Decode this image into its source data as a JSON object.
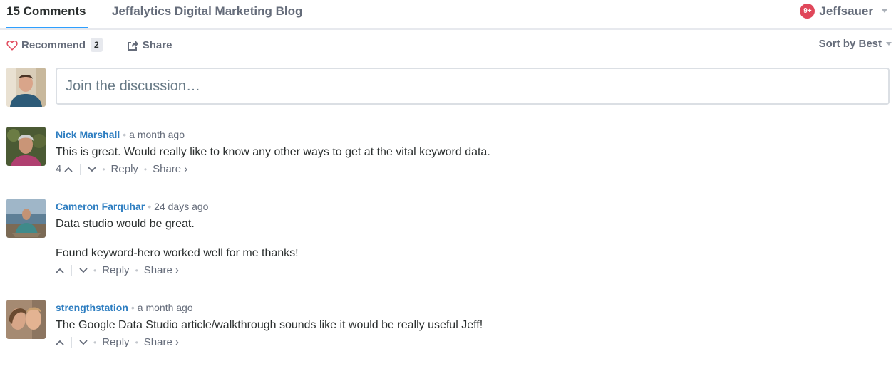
{
  "nav": {
    "comments_tab": "15 Comments",
    "blog_tab": "Jeffalytics Digital Marketing Blog",
    "notification_badge": "9+",
    "user_name": "Jeffsauer"
  },
  "actions": {
    "recommend_label": "Recommend",
    "recommend_count": "2",
    "share_label": "Share",
    "sort_label": "Sort by Best"
  },
  "compose": {
    "placeholder": "Join the discussion…"
  },
  "colors": {
    "accent": "#2e9fff",
    "author_link": "#2e7ec1",
    "notification": "#e0475a",
    "heart": "#e0475a"
  },
  "comments": [
    {
      "author": "Nick Marshall",
      "time": "a month ago",
      "paragraphs": [
        "This is great. Would really like to know any other ways to get at the vital keyword data."
      ],
      "upvotes": "4",
      "reply_label": "Reply",
      "share_label": "Share ›"
    },
    {
      "author": "Cameron Farquhar",
      "time": "24 days ago",
      "paragraphs": [
        "Data studio would be great.",
        "Found keyword-hero worked well for me thanks!"
      ],
      "upvotes": "",
      "reply_label": "Reply",
      "share_label": "Share ›"
    },
    {
      "author": "strengthstation",
      "time": "a month ago",
      "paragraphs": [
        "The Google Data Studio article/walkthrough sounds like it would be really useful Jeff!"
      ],
      "upvotes": "",
      "reply_label": "Reply",
      "share_label": "Share ›"
    }
  ]
}
